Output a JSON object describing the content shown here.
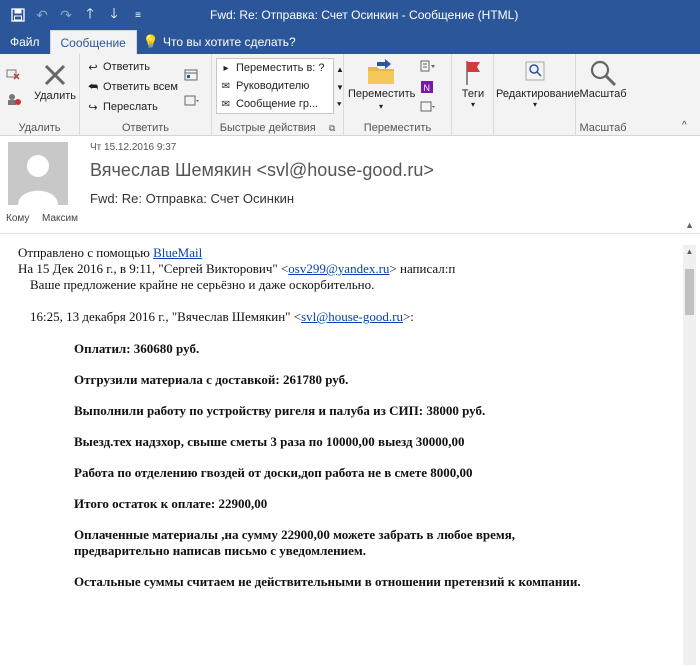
{
  "window": {
    "title": "Fwd: Re: Отправка: Счет Осинкин - Сообщение (HTML)"
  },
  "tabs": [
    {
      "label": "Файл"
    },
    {
      "label": "Сообщение"
    }
  ],
  "tell_me": "Что вы хотите сделать?",
  "ribbon": {
    "delete_group": {
      "label": "Удалить",
      "delete_button": "Удалить"
    },
    "reply_group": {
      "label": "Ответить",
      "reply": "Ответить",
      "reply_all": "Ответить всем",
      "forward": "Переслать"
    },
    "quick_steps": {
      "label": "Быстрые действия",
      "items": [
        "Переместить в: ?",
        "Руководителю",
        "Сообщение гр..."
      ]
    },
    "move_group": {
      "label": "Переместить",
      "move_button": "Переместить"
    },
    "tags_button": "Теги",
    "editing_button": "Редактирование",
    "zoom_group": {
      "label": "Масштаб",
      "zoom_button": "Масштаб"
    }
  },
  "message": {
    "date": "Чт 15.12.2016 9:37",
    "sender": "Вячеслав Шемякин <svl@house-good.ru>",
    "subject": "Fwd: Re: Отправка: Счет Осинкин",
    "to_label": "Кому",
    "to_name": "Максим"
  },
  "body": {
    "sent_with_prefix": "Отправлено с помощью ",
    "sent_with_link": "BlueMail",
    "quote1_prefix": "На 15 Дек 2016 г., в 9:11, \"Сергей Викторович\" <",
    "quote1_email": "osv299@yandex.ru",
    "quote1_suffix": "> написал:п",
    "reply_text": "Ваше предложение крайне не серьёзно и даже оскорбительно.",
    "quote2_prefix": "16:25, 13 декабря 2016 г., \"Вячеслав Шемякин\" <",
    "quote2_email": "svl@house-good.ru",
    "quote2_suffix": ">:",
    "paragraphs": [
      "Оплатил: 360680 руб.",
      "Отгрузили материала с доставкой: 261780 руб.",
      "Выполнили работу по устройству ригеля и палуба из СИП: 38000 руб.",
      "Выезд.тех надзхор, свыше сметы 3 раза по 10000,00 выезд 30000,00",
      "Работа по отделению гвоздей от доски,доп работа не в смете 8000,00",
      "Итого остаток к оплате: 22900,00",
      "Оплаченные материалы ,на сумму 22900,00 можете забрать в любое время,",
      "предварительно написав письмо с уведомлением.",
      "Остальные суммы считаем не действительными в отношении претензий к компании."
    ]
  }
}
